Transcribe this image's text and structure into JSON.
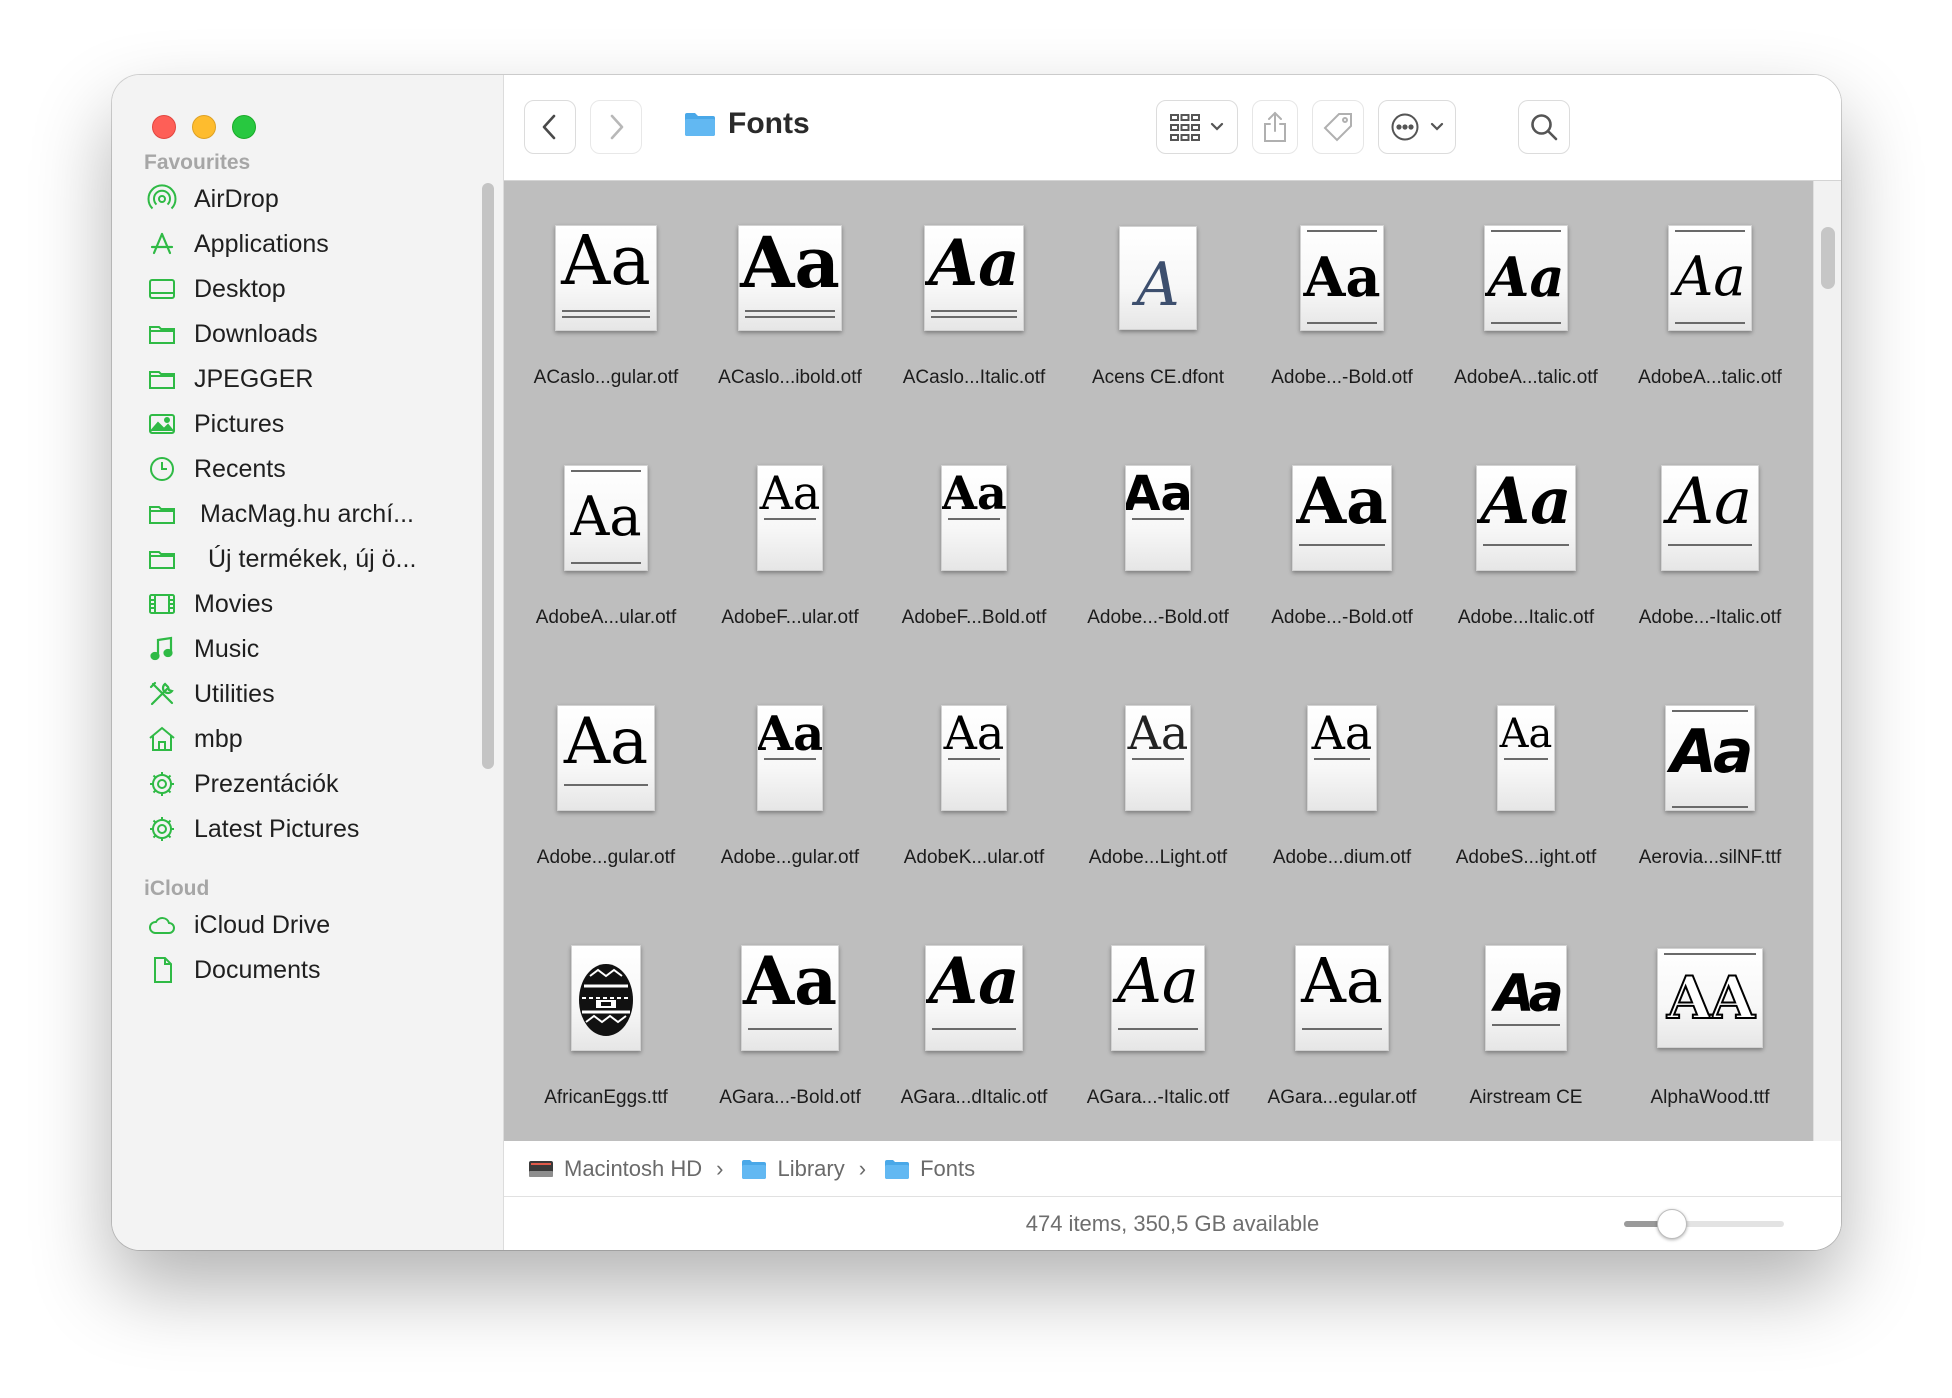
{
  "window": {
    "title": "Fonts"
  },
  "sidebar": {
    "sections": [
      {
        "label": "Favourites",
        "items": [
          {
            "label": "AirDrop",
            "icon": "airdrop-icon"
          },
          {
            "label": "Applications",
            "icon": "applications-icon"
          },
          {
            "label": "Desktop",
            "icon": "desktop-icon"
          },
          {
            "label": "Downloads",
            "icon": "folder-icon"
          },
          {
            "label": "JPEGGER",
            "icon": "folder-icon"
          },
          {
            "label": "Pictures",
            "icon": "pictures-icon"
          },
          {
            "label": "Recents",
            "icon": "clock-icon"
          },
          {
            "label": "MacMag.hu archí...",
            "icon": "folder-icon"
          },
          {
            "label": "Új termékek, új ö...",
            "icon": "folder-icon"
          },
          {
            "label": "Movies",
            "icon": "film-icon"
          },
          {
            "label": "Music",
            "icon": "music-note-icon"
          },
          {
            "label": "Utilities",
            "icon": "tools-icon"
          },
          {
            "label": "mbp",
            "icon": "home-icon"
          },
          {
            "label": "Prezentációk",
            "icon": "gear-icon"
          },
          {
            "label": "Latest Pictures",
            "icon": "gear-icon"
          }
        ]
      },
      {
        "label": "iCloud",
        "items": [
          {
            "label": "iCloud Drive",
            "icon": "cloud-icon"
          },
          {
            "label": "Documents",
            "icon": "document-icon"
          }
        ]
      }
    ]
  },
  "files": [
    {
      "name": "ACaslo...gular.otf",
      "glyph": "Aa"
    },
    {
      "name": "ACaslo...ibold.otf",
      "glyph": "Aa"
    },
    {
      "name": "ACaslo...Italic.otf",
      "glyph": "Aa"
    },
    {
      "name": "Acens CE.dfont",
      "glyph": "A"
    },
    {
      "name": "Adobe...-Bold.otf",
      "glyph": "Aa"
    },
    {
      "name": "AdobeA...talic.otf",
      "glyph": "Aa"
    },
    {
      "name": "AdobeA...talic.otf",
      "glyph": "Aa"
    },
    {
      "name": "AdobeA...ular.otf",
      "glyph": "Aa"
    },
    {
      "name": "AdobeF...ular.otf",
      "glyph": "Aa"
    },
    {
      "name": "AdobeF...Bold.otf",
      "glyph": "Aa"
    },
    {
      "name": "Adobe...-Bold.otf",
      "glyph": "Aa"
    },
    {
      "name": "Adobe...-Bold.otf",
      "glyph": "Aa"
    },
    {
      "name": "Adobe...Italic.otf",
      "glyph": "Aa"
    },
    {
      "name": "Adobe...-Italic.otf",
      "glyph": "Aa"
    },
    {
      "name": "Adobe...gular.otf",
      "glyph": "Aa"
    },
    {
      "name": "Adobe...gular.otf",
      "glyph": "Aa"
    },
    {
      "name": "AdobeK...ular.otf",
      "glyph": "Aa"
    },
    {
      "name": "Adobe...Light.otf",
      "glyph": "Aa"
    },
    {
      "name": "Adobe...dium.otf",
      "glyph": "Aa"
    },
    {
      "name": "AdobeS...ight.otf",
      "glyph": "Aa"
    },
    {
      "name": "Aerovia...silNF.ttf",
      "glyph": "Aa"
    },
    {
      "name": "AfricanEggs.ttf",
      "glyph": ""
    },
    {
      "name": "AGara...-Bold.otf",
      "glyph": "Aa"
    },
    {
      "name": "AGara...dItalic.otf",
      "glyph": "Aa"
    },
    {
      "name": "AGara...-Italic.otf",
      "glyph": "Aa"
    },
    {
      "name": "AGara...egular.otf",
      "glyph": "Aa"
    },
    {
      "name": "Airstream CE",
      "glyph": "Aa"
    },
    {
      "name": "AlphaWood.ttf",
      "glyph": "AA"
    }
  ],
  "pathbar": {
    "segments": [
      "Macintosh HD",
      "Library",
      "Fonts"
    ]
  },
  "status": {
    "text": "474 items, 350,5 GB available",
    "zoom": 0.3
  },
  "colors": {
    "accent": "#2fba45",
    "folder_blue": "#4aa8e8",
    "content_bg": "#bebebe"
  }
}
